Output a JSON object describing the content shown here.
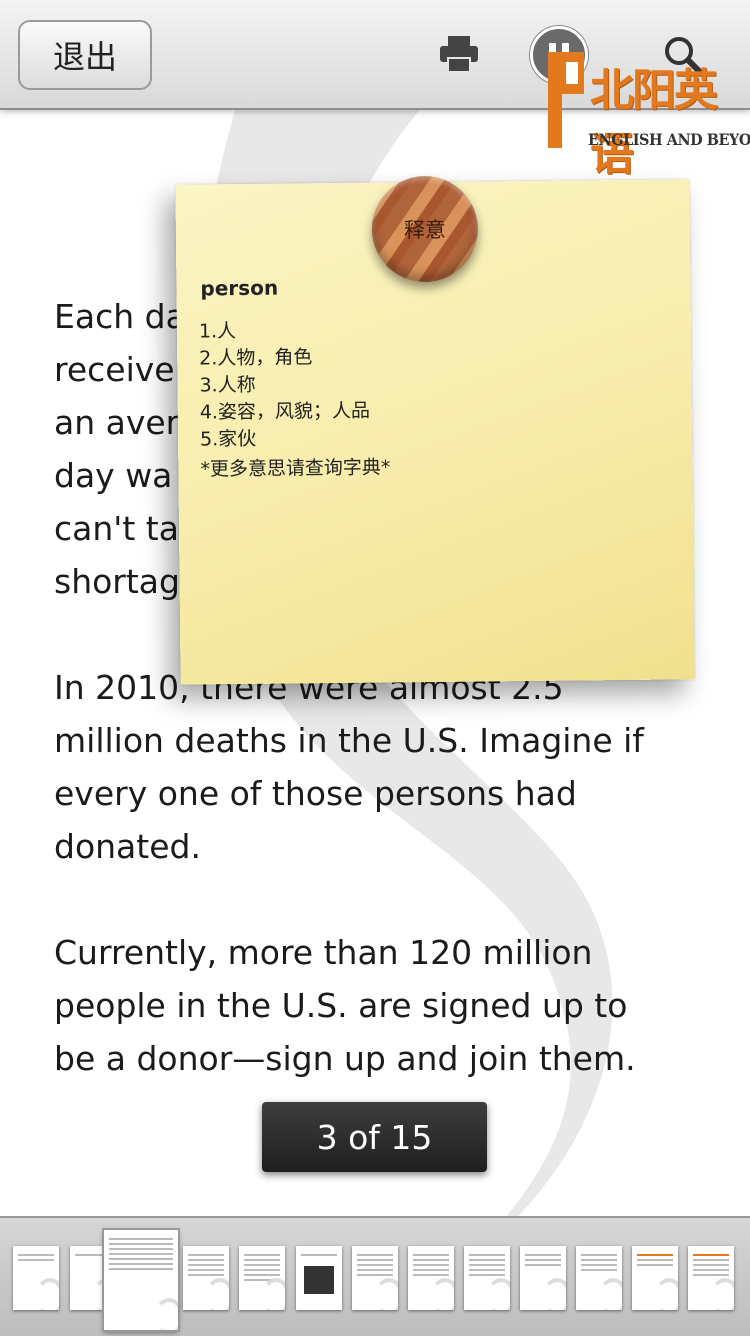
{
  "toolbar": {
    "exit_label": "退出",
    "icons": [
      "print-icon",
      "pause-icon",
      "search-icon"
    ]
  },
  "logo": {
    "cn": "北阳英语",
    "en": "ENGLISH AND BEYOND"
  },
  "content": {
    "paragraphs": [
      "Each da\nreceive\nan aver\nday wa\ncan't ta\nshortag",
      "In 2010, there were almost 2.5\nmillion deaths in the U.S. Imagine if\nevery one of those persons had\ndonated.",
      "Currently, more than 120 million\npeople in the U.S. are signed up to\nbe a donor—sign up and join them."
    ],
    "fragment_right": ";"
  },
  "dictionary_note": {
    "pin_label": "释意",
    "word": "person",
    "definitions": [
      "1.人",
      "2.人物，角色",
      "3.人称",
      "4.姿容，风貌；人品",
      "5.家伙"
    ],
    "more": "*更多意思请查询字典*"
  },
  "pager": {
    "label": "3 of 15",
    "current": 3,
    "total": 15
  },
  "colors": {
    "logo_orange": "#e2791f",
    "note_yellow": "#f7ecaa"
  }
}
